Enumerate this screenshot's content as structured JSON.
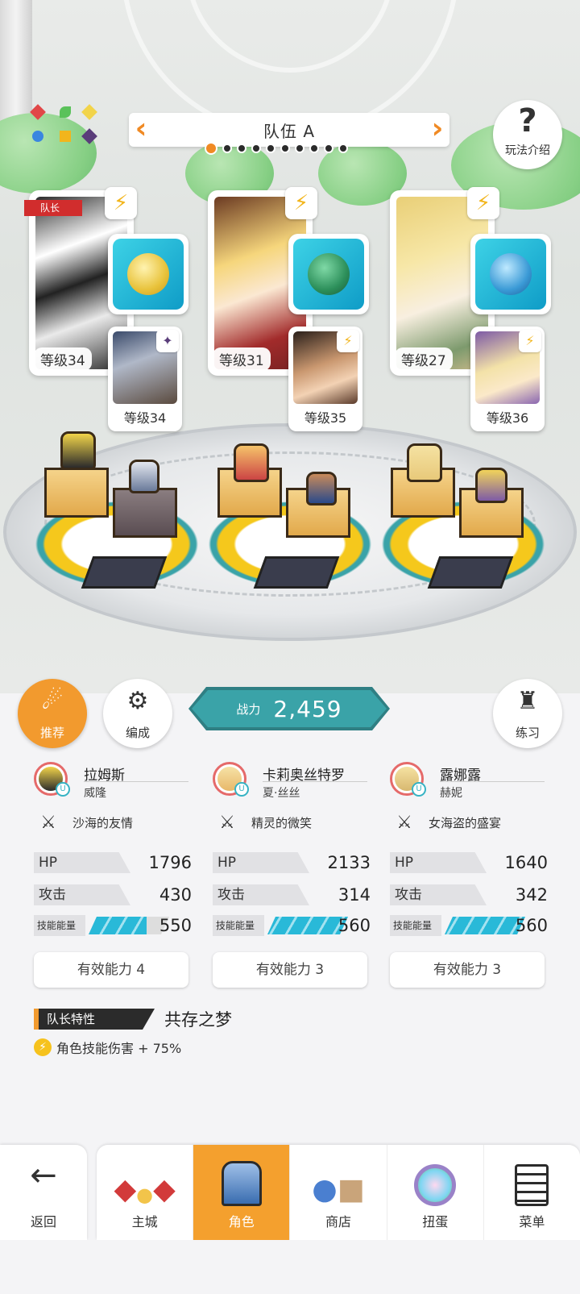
{
  "header": {
    "team_title": "队伍 A",
    "help_label": "玩法介绍",
    "help_icon": "question-icon",
    "active_dot": 0,
    "dots_total": 10
  },
  "cards": [
    {
      "leader_tag": "队长",
      "level": "等级34",
      "sub_level": "等级34"
    },
    {
      "level": "等级31",
      "sub_level": "等级35"
    },
    {
      "level": "等级27",
      "sub_level": "等级36"
    }
  ],
  "actions": {
    "recommend": "推荐",
    "formation": "编成",
    "practice": "练习",
    "power_label": "战力",
    "power_value": "2,459"
  },
  "members": [
    {
      "name": "拉姆斯",
      "sub": "威隆",
      "skill": "沙海的友情",
      "hp_label": "HP",
      "hp": "1796",
      "atk_label": "攻击",
      "atk": "430",
      "energy_label": "技能能量",
      "energy": "550",
      "energy_fill": 0.72,
      "ability": "有效能力 4"
    },
    {
      "name": "卡莉奥丝特罗",
      "sub": "夏·丝丝",
      "skill": "精灵的微笑",
      "hp_label": "HP",
      "hp": "2133",
      "atk_label": "攻击",
      "atk": "314",
      "energy_label": "技能能量",
      "energy": "560",
      "energy_fill": 1.0,
      "ability": "有效能力 3"
    },
    {
      "name": "露娜露",
      "sub": "赫妮",
      "skill": "女海盗的盛宴",
      "hp_label": "HP",
      "hp": "1640",
      "atk_label": "攻击",
      "atk": "342",
      "energy_label": "技能能量",
      "energy": "560",
      "energy_fill": 1.0,
      "ability": "有效能力 3"
    }
  ],
  "leader_trait": {
    "tag": "队长特性",
    "name": "共存之梦",
    "effect": "角色技能伤害 + 75%"
  },
  "nav": {
    "back": "返回",
    "tabs": [
      "主城",
      "角色",
      "商店",
      "扭蛋",
      "菜单"
    ],
    "active": 1
  },
  "colors": {
    "accent": "#f29a2e",
    "power_teal": "#3aa3a8",
    "energy": "#29b9d8",
    "leader_red": "#d12d2d"
  }
}
